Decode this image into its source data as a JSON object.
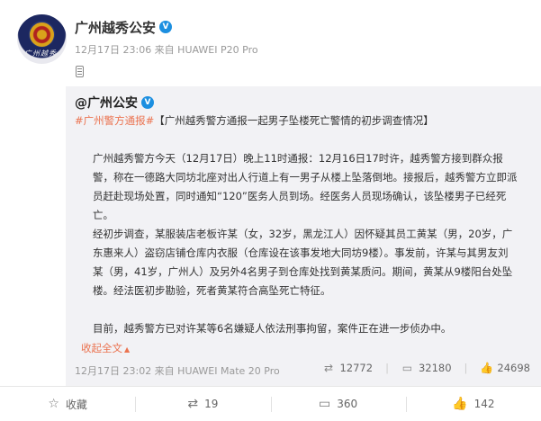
{
  "post": {
    "author": "广州越秀公安",
    "verified_mark": "V",
    "avatar_sign": "广州越秀",
    "meta": "12月17日 23:06 来自 HUAWEI P20 Pro"
  },
  "retweet": {
    "author": "@广州公安",
    "hashtag": "#广州警方通报#",
    "title": "【广州越秀警方通报一起男子坠楼死亡警情的初步调查情况】",
    "paragraphs": [
      "广州越秀警方今天（12月17日）晚上11时通报：12月16日17时许，越秀警方接到群众报警，称在一德路大同坊北座对出人行道上有一男子从楼上坠落倒地。接报后，越秀警方立即派员赶赴现场处置，同时通知“120”医务人员到场。经医务人员现场确认，该坠楼男子已经死亡。",
      "经初步调查，某服装店老板许某（女，32岁，黑龙江人）因怀疑其员工黄某（男，20岁，广东惠来人）盗窃店铺仓库内衣服（仓库设在该事发地大同坊9楼）。事发前，许某与其男友刘某（男，41岁，广州人）及另外4名男子到仓库处找到黄某质问。期间，黄某从9楼阳台处坠楼。经法医初步勘验，死者黄某符合高坠死亡特征。",
      "目前，越秀警方已对许某等6名嫌疑人依法刑事拘留，案件正在进一步侦办中。"
    ],
    "collapse_label": "收起全文",
    "meta": "12月17日 23:02 来自 HUAWEI Mate 20 Pro",
    "repost_count": "12772",
    "comment_count": "32180",
    "like_count": "24698"
  },
  "footer": {
    "favorite_label": "收藏",
    "repost_count": "19",
    "comment_count": "360",
    "like_count": "142"
  }
}
